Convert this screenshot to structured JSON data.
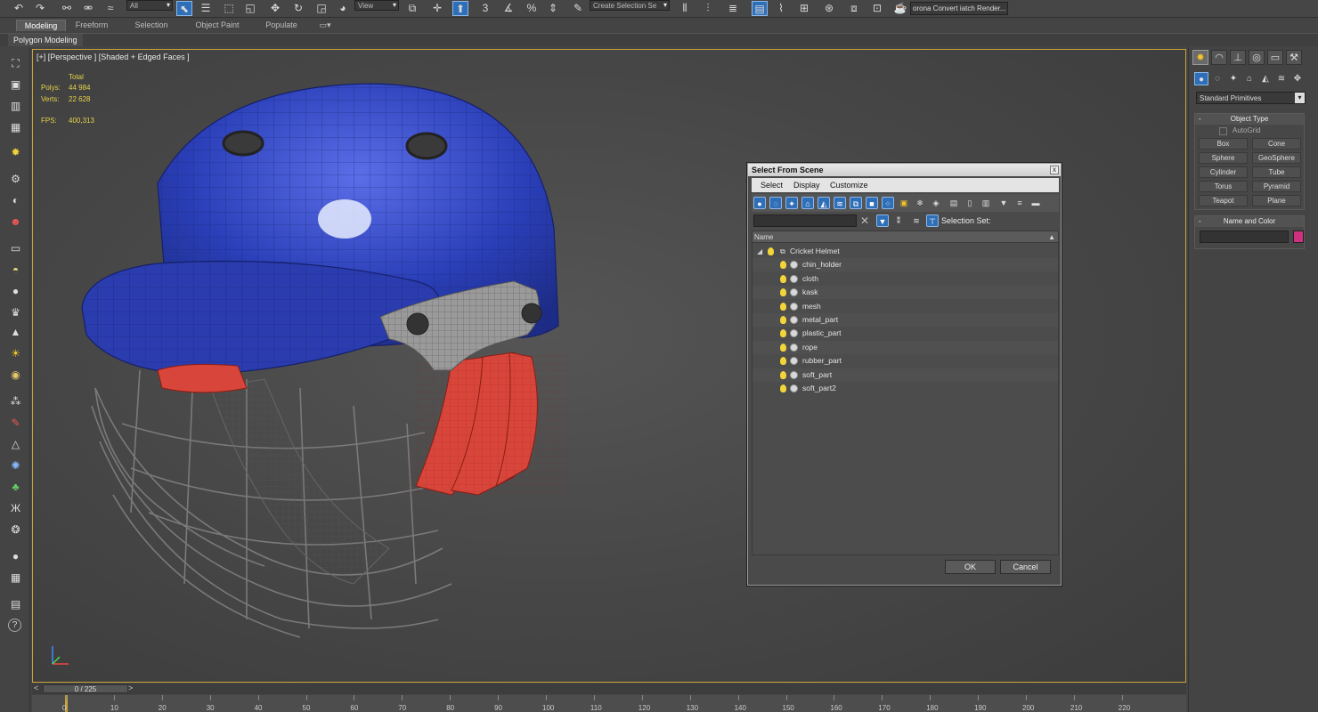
{
  "toolbar": {
    "selection_filter": "All",
    "ref_coord": "View",
    "selection_set_placeholder": "Create Selection Se",
    "render_label": "orona Convert iatch Render..."
  },
  "ribbon": {
    "tabs": [
      "Modeling",
      "Freeform",
      "Selection",
      "Object Paint",
      "Populate"
    ],
    "active_tab": "Modeling",
    "sub_label": "Polygon Modeling"
  },
  "viewport": {
    "label": "[+] [Perspective ] [Shaded + Edged Faces ]",
    "stats": {
      "total_label": "Total",
      "polys_label": "Polys:",
      "polys_value": "44 984",
      "verts_label": "Verts:",
      "verts_value": "22 628",
      "fps_label": "FPS:",
      "fps_value": "400,313"
    },
    "colors": {
      "shell": "#2a3fb8",
      "pads": "#d8453a",
      "metal": "#8c8c8c",
      "active_border": "#c8a23a"
    }
  },
  "command_panel": {
    "category": "Standard Primitives",
    "object_type_title": "Object Type",
    "autogrid_label": "AutoGrid",
    "primitives": [
      "Box",
      "Cone",
      "Sphere",
      "GeoSphere",
      "Cylinder",
      "Tube",
      "Torus",
      "Pyramid",
      "Teapot",
      "Plane"
    ],
    "name_color_title": "Name and Color",
    "object_color": "#d0307e"
  },
  "dialog": {
    "title": "Select From Scene",
    "close_glyph": "x",
    "menu": [
      "Select",
      "Display",
      "Customize"
    ],
    "selection_set_label": "Selection Set:",
    "column_name": "Name",
    "root": "Cricket Helmet",
    "items": [
      "chin_holder",
      "cloth",
      "kask",
      "mesh",
      "metal_part",
      "plastic_part",
      "rope",
      "rubber_part",
      "soft_part",
      "soft_part2"
    ],
    "ok_label": "OK",
    "cancel_label": "Cancel"
  },
  "timeline": {
    "frame_display": "0 / 225",
    "ticks": [
      "0",
      "10",
      "20",
      "30",
      "40",
      "50",
      "60",
      "70",
      "80",
      "90",
      "100",
      "110",
      "120",
      "130",
      "140",
      "150",
      "160",
      "170",
      "180",
      "190",
      "200",
      "210",
      "220"
    ]
  }
}
